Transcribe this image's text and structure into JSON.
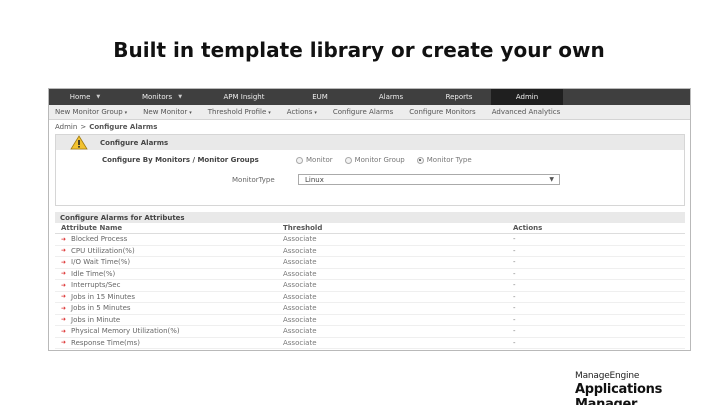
{
  "slide": {
    "title": "Built in template library or create your own"
  },
  "topnav": {
    "items": [
      {
        "label": "Home",
        "has_dropdown": true
      },
      {
        "label": "Monitors",
        "has_dropdown": true
      },
      {
        "label": "APM Insight",
        "has_dropdown": false
      },
      {
        "label": "EUM",
        "has_dropdown": false
      },
      {
        "label": "Alarms",
        "has_dropdown": false
      },
      {
        "label": "Reports",
        "has_dropdown": false
      },
      {
        "label": "Admin",
        "has_dropdown": false,
        "active": true
      }
    ],
    "dropdown_glyph": "▼"
  },
  "subnav": {
    "items": [
      {
        "label": "New Monitor Group",
        "dd": "▾"
      },
      {
        "label": "New Monitor",
        "dd": "▾"
      },
      {
        "label": "Threshold Profile",
        "dd": "▾"
      },
      {
        "label": "Actions",
        "dd": "▾"
      },
      {
        "label": "Configure Alarms",
        "dd": ""
      },
      {
        "label": "Configure Monitors",
        "dd": ""
      },
      {
        "label": "Advanced Analytics",
        "dd": ""
      }
    ]
  },
  "breadcrumb": {
    "parent": "Admin",
    "separator": ">",
    "current": "Configure Alarms"
  },
  "configure": {
    "header": "Configure Alarms",
    "icon": "warning-icon",
    "by_label": "Configure By Monitors / Monitor Groups",
    "radios": [
      {
        "label": "Monitor",
        "selected": false
      },
      {
        "label": "Monitor Group",
        "selected": false
      },
      {
        "label": "Monitor Type",
        "selected": true
      }
    ],
    "type_label": "MonitorType",
    "type_value": "Linux",
    "select_arrow": "▼"
  },
  "attributes": {
    "title": "Configure Alarms for Attributes",
    "columns": [
      "Attribute Name",
      "Threshold",
      "Actions"
    ],
    "bullet": "➜",
    "rows": [
      {
        "name": "Blocked Process",
        "threshold": "Associate",
        "action": "-"
      },
      {
        "name": "CPU Utilization(%)",
        "threshold": "Associate",
        "action": "-"
      },
      {
        "name": "I/O Wait Time(%)",
        "threshold": "Associate",
        "action": "-"
      },
      {
        "name": "Idle Time(%)",
        "threshold": "Associate",
        "action": "-"
      },
      {
        "name": "Interrupts/Sec",
        "threshold": "Associate",
        "action": "-"
      },
      {
        "name": "Jobs in 15 Minutes",
        "threshold": "Associate",
        "action": "-"
      },
      {
        "name": "Jobs in 5 Minutes",
        "threshold": "Associate",
        "action": "-"
      },
      {
        "name": "Jobs in Minute",
        "threshold": "Associate",
        "action": "-"
      },
      {
        "name": "Physical Memory Utilization(%)",
        "threshold": "Associate",
        "action": "-"
      },
      {
        "name": "Response Time(ms)",
        "threshold": "Associate",
        "action": "-"
      }
    ]
  },
  "branding": {
    "line1": "ManageEngine",
    "line2": "Applications Manager"
  }
}
